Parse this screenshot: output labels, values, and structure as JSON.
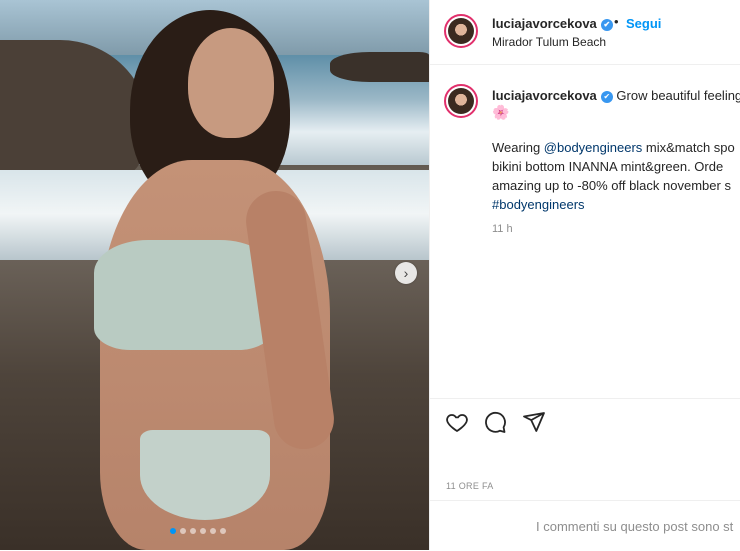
{
  "post": {
    "username": "luciajavorcekova",
    "verified_symbol": "✔",
    "follow_bullet": "•",
    "follow_label": "Segui",
    "location": "Mirador Tulum Beach"
  },
  "caption": {
    "username": "luciajavorcekova",
    "head_text": "Grow beautiful feeling",
    "flower": "🌸",
    "line1_pre": "Wearing ",
    "line1_mention": "@bodyengineers",
    "line1_post": " mix&match spo",
    "line2": "bikini bottom INANNA mint&green. Orde",
    "line3": "amazing up to -80% off black november s",
    "hashtag": "#bodyengineers",
    "time": "11 h"
  },
  "media": {
    "carousel_count": 6,
    "active_index": 0,
    "next_symbol": "›"
  },
  "actions": {
    "like_icon": "heart-icon",
    "comment_icon": "comment-icon",
    "share_icon": "send-icon"
  },
  "footer": {
    "date": "11 ORE FA",
    "comments_disabled": "I commenti su questo post sono st"
  },
  "colors": {
    "link_blue": "#0095f6",
    "mention_blue": "#00376b",
    "verified_blue": "#3897f0",
    "muted": "#8e8e8e"
  }
}
